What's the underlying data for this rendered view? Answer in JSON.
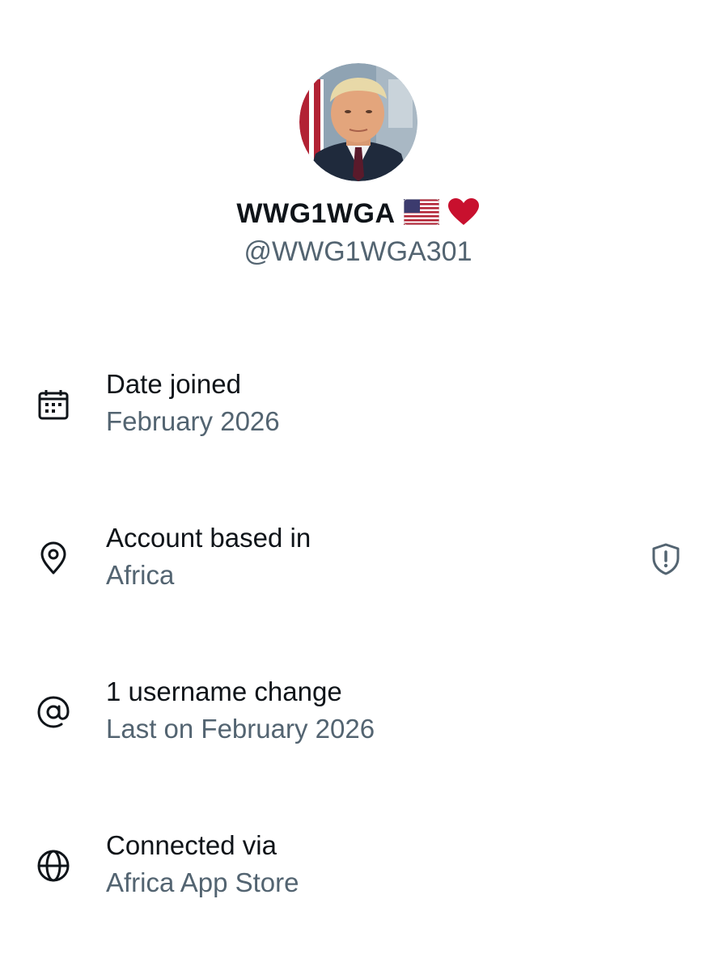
{
  "profile": {
    "display_name": "WWG1WGA",
    "handle": "@WWG1WGA301",
    "name_emojis": [
      "us-flag-emoji",
      "red-heart-emoji"
    ],
    "avatar": "profile-photo"
  },
  "about": {
    "rows": [
      {
        "icon": "calendar-icon",
        "title": "Date joined",
        "value": "February 2026"
      },
      {
        "icon": "location-pin-icon",
        "title": "Account based in",
        "value": "Africa",
        "trailing_icon": "shield-alert-icon"
      },
      {
        "icon": "at-sign-icon",
        "title": "1 username change",
        "value": "Last on February 2026"
      },
      {
        "icon": "globe-icon",
        "title": "Connected via",
        "value": "Africa App Store"
      }
    ]
  },
  "colors": {
    "primary_text": "#0f1419",
    "secondary_text": "#536471",
    "heart": "#c8102e",
    "background": "#ffffff"
  }
}
